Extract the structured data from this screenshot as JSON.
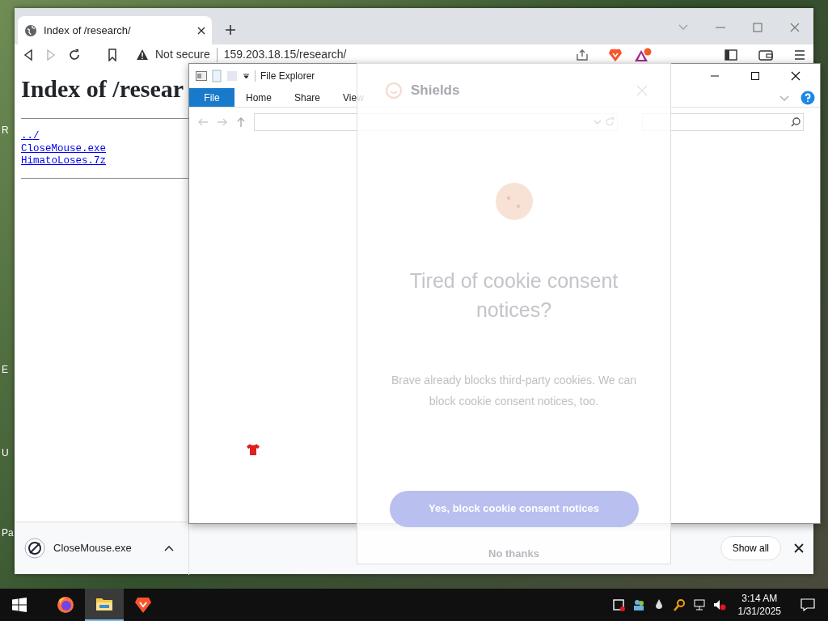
{
  "desktop": {
    "icon_labels": [
      "R",
      "E",
      "U",
      "Pa"
    ]
  },
  "browser": {
    "tab": {
      "title": "Index of /research/"
    },
    "security": "Not secure",
    "url": "159.203.18.15/research/",
    "page": {
      "heading": "Index of /resear",
      "links": [
        "../",
        "CloseMouse.exe",
        "HimatoLoses.7z"
      ]
    },
    "downloads": {
      "file": "CloseMouse.exe",
      "show_all": "Show all"
    }
  },
  "explorer": {
    "title": "File Explorer",
    "ribbon_tabs": [
      {
        "label": "File",
        "selected": true
      },
      {
        "label": "Home",
        "selected": false
      },
      {
        "label": "Share",
        "selected": false
      },
      {
        "label": "View",
        "selected": false
      }
    ]
  },
  "shields_popup": {
    "title": "Shields",
    "heading": "Tired of cookie consent notices?",
    "body": "Brave already blocks third-party cookies. We can block cookie consent notices, too.",
    "primary_button": "Yes, block cookie consent notices",
    "secondary_button": "No thanks"
  },
  "taskbar": {
    "apps": [
      {
        "kind": "firefox",
        "selected": false
      },
      {
        "kind": "explorer",
        "selected": true
      },
      {
        "kind": "brave",
        "selected": false
      }
    ],
    "time": "3:14 AM",
    "date": "1/31/2025"
  }
}
